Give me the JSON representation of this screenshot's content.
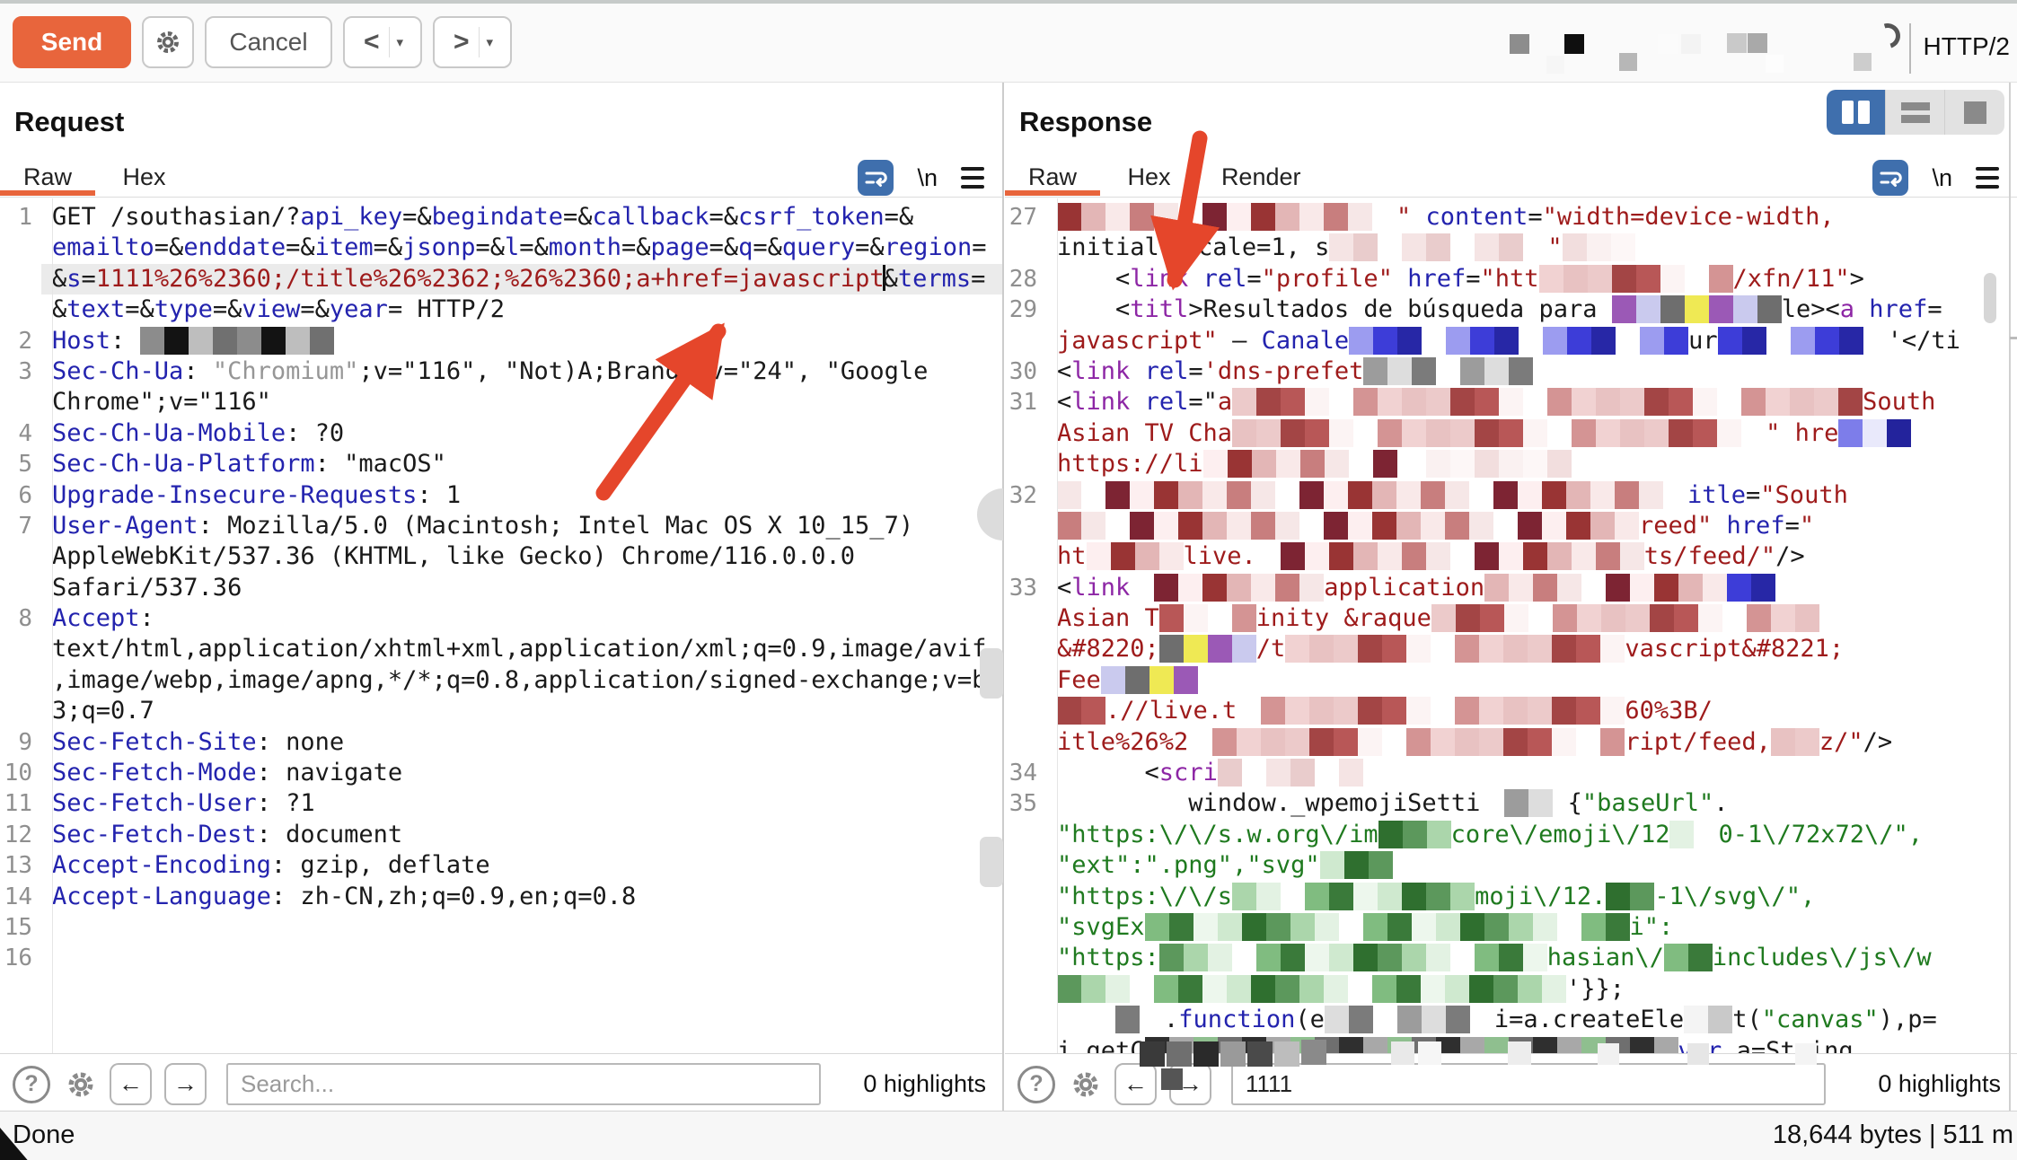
{
  "toolbar": {
    "send_label": "Send",
    "cancel_label": "Cancel",
    "prev_label": "<",
    "next_label": ">",
    "caret_label": "▾",
    "http_version": "HTTP/2"
  },
  "request_panel": {
    "title": "Request",
    "tabs": [
      "Raw",
      "Hex"
    ],
    "active_tab": "Raw",
    "newline_label": "\\n",
    "search_placeholder": "Search...",
    "highlights": "0 highlights",
    "help_label": "?",
    "prev_match_label": "←",
    "next_match_label": "→"
  },
  "response_panel": {
    "title": "Response",
    "tabs": [
      "Raw",
      "Hex",
      "Render"
    ],
    "active_tab": "Raw",
    "newline_label": "\\n",
    "search_value": "1111",
    "highlights": "0 highlights",
    "help_label": "?",
    "prev_match_label": "←",
    "next_match_label": "→"
  },
  "status_bar": {
    "left": "Done",
    "right": "18,644 bytes | 511 m"
  },
  "colors": {
    "accent_orange": "#e8653c",
    "arrow_red": "#e5462b",
    "selected_blue": "#3f6fad",
    "param_name_blue": "#2323ae",
    "value_maroon": "#9e1b1b",
    "tag_purple": "#8d26a5",
    "string_green": "#1f7a1f",
    "selection_gray": "#ebebeb"
  },
  "mosaic_palettes": {
    "warm": [
      "#f6e7e7",
      "#ffffff",
      "#e3b6b6",
      "#a34545",
      "#7d2433",
      "#f1d2d2",
      "#c87e7e",
      "#fcf4f4",
      "#993434",
      "#eccaca",
      "#ffffff",
      "#d49494",
      "#f9e9e9",
      "#b85757",
      "#fdeff0",
      "#e8c2c2"
    ],
    "warmlight": [
      "#faf1f1",
      "#ffffff",
      "#f2dede",
      "#e9cccc",
      "#fdf7f7",
      "#f5e4e4"
    ],
    "accent": [
      "#d9d9de",
      "#6e6e6e",
      "#151515",
      "#efe954",
      "#ffffff",
      "#9b59b6",
      "#7c2a7c",
      "#cacaee"
    ],
    "blue": [
      "#3d3dd8",
      "#7d7dea",
      "#2727a6",
      "#e9e9fb",
      "#ffffff",
      "#23239c",
      "#9c9cf0",
      "#d5d5f7"
    ],
    "gray": [
      "#5a5a5a",
      "#9c9c9c",
      "#181818",
      "#dddddd",
      "#f4f4f4",
      "#7b7b7b",
      "#c9c9c9",
      "#ffffff"
    ],
    "green": [
      "#2f6f2f",
      "#5c985c",
      "#abd6ab",
      "#e3f2e3",
      "#ffffff",
      "#80bc80",
      "#3a7a3a",
      "#edf7ed",
      "#cfe9cf"
    ],
    "hostgray": [
      "#8c8c8c",
      "#4b4b4b",
      "#131313",
      "#ececec",
      "#bebebe",
      "#f7f7f7",
      "#707070",
      "#d9d9d9"
    ],
    "graygreen": [
      "#6f6f6f",
      "#cfe5cf",
      "#2f2f2f",
      "#e9f4e9",
      "#a8a8a8",
      "#ffffff",
      "#8fbf8f",
      "#dddddd"
    ]
  },
  "request_rows": [
    {
      "n": "1",
      "seg": [
        [
          "k",
          "GET /southasian/?"
        ],
        [
          "b",
          "api_key"
        ],
        [
          "k",
          "=&"
        ],
        [
          "b",
          "begindate"
        ],
        [
          "k",
          "=&"
        ],
        [
          "b",
          "callback"
        ],
        [
          "k",
          "=&"
        ],
        [
          "b",
          "csrf_token"
        ],
        [
          "k",
          "=&"
        ]
      ]
    },
    {
      "n": "",
      "seg": [
        [
          "b",
          "emailto"
        ],
        [
          "k",
          "=&"
        ],
        [
          "b",
          "enddate"
        ],
        [
          "k",
          "=&"
        ],
        [
          "b",
          "item"
        ],
        [
          "k",
          "=&"
        ],
        [
          "b",
          "jsonp"
        ],
        [
          "k",
          "=&"
        ],
        [
          "b",
          "l"
        ],
        [
          "k",
          "=&"
        ],
        [
          "b",
          "month"
        ],
        [
          "k",
          "=&"
        ],
        [
          "b",
          "page"
        ],
        [
          "k",
          "=&"
        ],
        [
          "b",
          "q"
        ],
        [
          "k",
          "=&"
        ],
        [
          "b",
          "query"
        ],
        [
          "k",
          "=&"
        ],
        [
          "b",
          "region"
        ],
        [
          "k",
          "="
        ]
      ]
    },
    {
      "n": "",
      "hl": true,
      "seg": [
        [
          "k",
          "&"
        ],
        [
          "b",
          "s"
        ],
        [
          "k",
          "="
        ],
        [
          "r",
          "1111%26%2360;/title%26%2362;%26%2360;a+href=javascript"
        ],
        [
          "cur"
        ],
        [
          "k",
          "&"
        ],
        [
          "b",
          "terms"
        ],
        [
          "k",
          "="
        ]
      ]
    },
    {
      "n": "",
      "seg": [
        [
          "k",
          "&"
        ],
        [
          "b",
          "text"
        ],
        [
          "k",
          "=&"
        ],
        [
          "b",
          "type"
        ],
        [
          "k",
          "=&"
        ],
        [
          "b",
          "view"
        ],
        [
          "k",
          "=&"
        ],
        [
          "b",
          "year"
        ],
        [
          "k",
          "= HTTP/2"
        ]
      ]
    },
    {
      "n": "2",
      "seg": [
        [
          "b",
          "Host"
        ],
        [
          "k",
          ": "
        ],
        [
          "m",
          "hostgray",
          8
        ]
      ]
    },
    {
      "n": "3",
      "seg": [
        [
          "b",
          "Sec-Ch-Ua"
        ],
        [
          "k",
          ": "
        ],
        [
          "kf",
          "\"Chromium\""
        ],
        [
          "k",
          ";v=\"116\", \"Not)A;Brand\";v=\"24\", \"Google"
        ]
      ]
    },
    {
      "n": "",
      "seg": [
        [
          "k",
          "Chrome\";v=\"116\""
        ]
      ]
    },
    {
      "n": "4",
      "seg": [
        [
          "b",
          "Sec-Ch-Ua-Mobile"
        ],
        [
          "k",
          ": ?0"
        ]
      ]
    },
    {
      "n": "5",
      "seg": [
        [
          "b",
          "Sec-Ch-Ua-Platform"
        ],
        [
          "k",
          ": \"macOS\""
        ]
      ]
    },
    {
      "n": "6",
      "seg": [
        [
          "b",
          "Upgrade-Insecure-Requests"
        ],
        [
          "k",
          ": 1"
        ]
      ]
    },
    {
      "n": "7",
      "seg": [
        [
          "b",
          "User-Agent"
        ],
        [
          "k",
          ": Mozilla/5.0 (Macintosh; Intel Mac OS X 10_15_7)"
        ]
      ]
    },
    {
      "n": "",
      "seg": [
        [
          "k",
          "AppleWebKit/537.36 (KHTML, like Gecko) Chrome/116.0.0.0"
        ]
      ]
    },
    {
      "n": "",
      "seg": [
        [
          "k",
          "Safari/537.36"
        ]
      ]
    },
    {
      "n": "8",
      "seg": [
        [
          "b",
          "Accept"
        ],
        [
          "k",
          ":"
        ]
      ]
    },
    {
      "n": "",
      "seg": [
        [
          "k",
          "text/html,application/xhtml+xml,application/xml;q=0.9,image/avif"
        ]
      ]
    },
    {
      "n": "",
      "seg": [
        [
          "k",
          ",image/webp,image/apng,*/*;q=0.8,application/signed-exchange;v=b"
        ]
      ]
    },
    {
      "n": "",
      "seg": [
        [
          "k",
          "3;q=0.7"
        ]
      ]
    },
    {
      "n": "9",
      "seg": [
        [
          "b",
          "Sec-Fetch-Site"
        ],
        [
          "k",
          ": none"
        ]
      ]
    },
    {
      "n": "10",
      "seg": [
        [
          "b",
          "Sec-Fetch-Mode"
        ],
        [
          "k",
          ": navigate"
        ]
      ]
    },
    {
      "n": "11",
      "seg": [
        [
          "b",
          "Sec-Fetch-User"
        ],
        [
          "k",
          ": ?1"
        ]
      ]
    },
    {
      "n": "12",
      "seg": [
        [
          "b",
          "Sec-Fetch-Dest"
        ],
        [
          "k",
          ": document"
        ]
      ]
    },
    {
      "n": "13",
      "seg": [
        [
          "b",
          "Accept-Encoding"
        ],
        [
          "k",
          ": gzip, deflate"
        ]
      ]
    },
    {
      "n": "14",
      "seg": [
        [
          "b",
          "Accept-Language"
        ],
        [
          "k",
          ": zh-CN,zh;q=0.9,en;q=0.8"
        ]
      ]
    },
    {
      "n": "15",
      "seg": []
    },
    {
      "n": "16",
      "seg": []
    }
  ],
  "response_rows": [
    {
      "n": "27",
      "seg": [
        [
          "m",
          "warm",
          14
        ],
        [
          "r",
          "\" "
        ],
        [
          "b",
          "content"
        ],
        [
          "k",
          "="
        ],
        [
          "r",
          "\"width=device-width,"
        ]
      ]
    },
    {
      "n": "",
      "seg": [
        [
          "k",
          "initial"
        ],
        [
          "m",
          "warm",
          1
        ],
        [
          "k",
          "scale=1, s"
        ],
        [
          "m",
          "warmlight",
          9
        ],
        [
          "r",
          "\""
        ],
        [
          "m",
          "warmlight",
          3
        ]
      ]
    },
    {
      "n": "28",
      "seg": [
        [
          "k",
          "    <"
        ],
        [
          "p",
          "link"
        ],
        [
          "k",
          " "
        ],
        [
          "b",
          "rel"
        ],
        [
          "k",
          "="
        ],
        [
          "r",
          "\"profile\""
        ],
        [
          "k",
          " "
        ],
        [
          "b",
          "href"
        ],
        [
          "k",
          "="
        ],
        [
          "r",
          "\"htt"
        ],
        [
          "m",
          "warm",
          8
        ],
        [
          "r",
          "/xfn/11\""
        ],
        [
          "k",
          ">"
        ]
      ]
    },
    {
      "n": "29",
      "seg": [
        [
          "k",
          "    <"
        ],
        [
          "p",
          "titl"
        ],
        [
          "k",
          ">Resultados de búsqueda para "
        ],
        [
          "m",
          "accent",
          7
        ],
        [
          "k",
          "le>"
        ],
        [
          "k",
          "<"
        ],
        [
          "p",
          "a"
        ],
        [
          "k",
          " "
        ],
        [
          "b",
          "href"
        ],
        [
          "k",
          "="
        ]
      ]
    },
    {
      "n": "",
      "seg": [
        [
          "r",
          "javascript\""
        ],
        [
          "k",
          " – "
        ],
        [
          "b",
          "Canale"
        ],
        [
          "m",
          "blue",
          14
        ],
        [
          "k",
          "ur"
        ],
        [
          "m",
          "blue",
          7
        ],
        [
          "k",
          "'</ti"
        ]
      ]
    },
    {
      "n": "30",
      "seg": [
        [
          "k",
          "<"
        ],
        [
          "p",
          "link"
        ],
        [
          "k",
          " "
        ],
        [
          "b",
          "rel"
        ],
        [
          "k",
          "="
        ],
        [
          "r",
          "'dns-prefet"
        ],
        [
          "m",
          "gray",
          8
        ]
      ]
    },
    {
      "n": "31",
      "seg": [
        [
          "k",
          "<"
        ],
        [
          "p",
          "link"
        ],
        [
          "k",
          " "
        ],
        [
          "b",
          "rel"
        ],
        [
          "k",
          "=\""
        ],
        [
          "r",
          "a"
        ],
        [
          "m",
          "warm",
          26
        ],
        [
          "r",
          "South"
        ]
      ]
    },
    {
      "n": "",
      "seg": [
        [
          "r",
          "Asian TV Cha"
        ],
        [
          "m",
          "warm",
          22
        ],
        [
          "r",
          "\" hre"
        ],
        [
          "m",
          "blue",
          3
        ]
      ]
    },
    {
      "n": "",
      "seg": [
        [
          "r",
          "https://li"
        ],
        [
          "m",
          "warm",
          8
        ],
        [
          "k",
          "  "
        ],
        [
          "m",
          "warmlight",
          6
        ]
      ]
    },
    {
      "n": "32",
      "seg": [
        [
          "m",
          "warm",
          26
        ],
        [
          "b",
          "itle"
        ],
        [
          "k",
          "="
        ],
        [
          "r",
          "\"South"
        ]
      ]
    },
    {
      "n": "",
      "seg": [
        [
          "m",
          "warm",
          24
        ],
        [
          "r",
          "reed\" "
        ],
        [
          "b",
          "href"
        ],
        [
          "k",
          "="
        ],
        [
          "r",
          "\""
        ]
      ]
    },
    {
      "n": "",
      "seg": [
        [
          "r",
          "ht"
        ],
        [
          "m",
          "warm",
          4
        ],
        [
          "r",
          "live."
        ],
        [
          "m",
          "warm",
          16
        ],
        [
          "r",
          "ts/feed/\""
        ],
        [
          "k",
          "/>"
        ]
      ]
    },
    {
      "n": "33",
      "seg": [
        [
          "k",
          "<"
        ],
        [
          "p",
          "link"
        ],
        [
          "m",
          "warm",
          8
        ],
        [
          "r",
          "application"
        ],
        [
          "m",
          "warm",
          10
        ],
        [
          "m",
          "blue",
          3
        ]
      ]
    },
    {
      "n": "",
      "seg": [
        [
          "r",
          "Asian T"
        ],
        [
          "m",
          "warm",
          4
        ],
        [
          "r",
          "inity &raque"
        ],
        [
          "m",
          "warm",
          16
        ]
      ]
    },
    {
      "n": "",
      "seg": [
        [
          "r",
          "&#8220;"
        ],
        [
          "m",
          "accent",
          4
        ],
        [
          "r",
          "/t"
        ],
        [
          "m",
          "warm",
          14
        ],
        [
          "r",
          "vascript&#8221;"
        ]
      ]
    },
    {
      "n": "",
      "seg": [
        [
          "r",
          "Fee"
        ],
        [
          "m",
          "accent",
          4
        ]
      ]
    },
    {
      "n": "",
      "seg": [
        [
          "m",
          "warm",
          2
        ],
        [
          "r",
          ".//live.t"
        ],
        [
          "m",
          "warm",
          16
        ],
        [
          "r",
          "60%3B/"
        ]
      ]
    },
    {
      "n": "",
      "seg": [
        [
          "r",
          "itle%26%2"
        ],
        [
          "m",
          "warm",
          18
        ],
        [
          "r",
          "ript/feed,"
        ],
        [
          "m",
          "warm",
          2
        ],
        [
          "r",
          "z/\""
        ],
        [
          "k",
          "/>"
        ]
      ]
    },
    {
      "n": "34",
      "seg": [
        [
          "k",
          "      <"
        ],
        [
          "p",
          "scri"
        ],
        [
          "m",
          "warmlight",
          6
        ]
      ]
    },
    {
      "n": "35",
      "seg": [
        [
          "k",
          "         window._wpemojiSetti"
        ],
        [
          "m",
          "gray",
          3
        ],
        [
          "k",
          " {"
        ],
        [
          "g",
          "\"baseUrl\""
        ],
        [
          "k",
          "."
        ]
      ]
    },
    {
      "n": "",
      "seg": [
        [
          "g",
          "\"https:\\/\\/s.w.org\\/im"
        ],
        [
          "m",
          "green",
          3
        ],
        [
          "g",
          "core\\/emoji\\/12"
        ],
        [
          "m",
          "green",
          2
        ],
        [
          "g",
          "0-1\\/72x72\\/\","
        ]
      ]
    },
    {
      "n": "",
      "seg": [
        [
          "g",
          "\"ext\":\".png\",\"svg\""
        ],
        [
          "m",
          "green",
          3
        ]
      ]
    },
    {
      "n": "",
      "seg": [
        [
          "g",
          "\"https:\\/\\/s"
        ],
        [
          "m",
          "green",
          10
        ],
        [
          "g",
          "moji\\/12."
        ],
        [
          "m",
          "green",
          2
        ],
        [
          "g",
          "-1\\/svg\\/\","
        ]
      ]
    },
    {
      "n": "",
      "seg": [
        [
          "g",
          "\"svgEx"
        ],
        [
          "m",
          "green",
          20
        ],
        [
          "g",
          "i\":"
        ]
      ]
    },
    {
      "n": "",
      "seg": [
        [
          "g",
          "\"https:"
        ],
        [
          "m",
          "green",
          16
        ],
        [
          "g",
          "hasian\\/"
        ],
        [
          "m",
          "green",
          2
        ],
        [
          "g",
          "includes\\/js\\/w"
        ]
      ]
    },
    {
      "n": "",
      "seg": [
        [
          "m",
          "green",
          21
        ],
        [
          "k",
          "'}};"
        ]
      ]
    },
    {
      "n": "",
      "seg": [
        [
          "k",
          "    "
        ],
        [
          "m",
          "gray",
          2
        ],
        [
          "k",
          "."
        ],
        [
          "b2",
          "function"
        ],
        [
          "k",
          "(e"
        ],
        [
          "m",
          "gray",
          7
        ],
        [
          "k",
          "i=a.createEle"
        ],
        [
          "m",
          "gray",
          2
        ],
        [
          "k",
          "t("
        ],
        [
          "g",
          "\"canvas\""
        ],
        [
          "k",
          "),p="
        ]
      ]
    },
    {
      "n": "",
      "seg": [
        [
          "k",
          "i.getC"
        ],
        [
          "m",
          "graygreen",
          22
        ],
        [
          "b2",
          "var"
        ],
        [
          "k",
          " a=String."
        ]
      ]
    }
  ]
}
